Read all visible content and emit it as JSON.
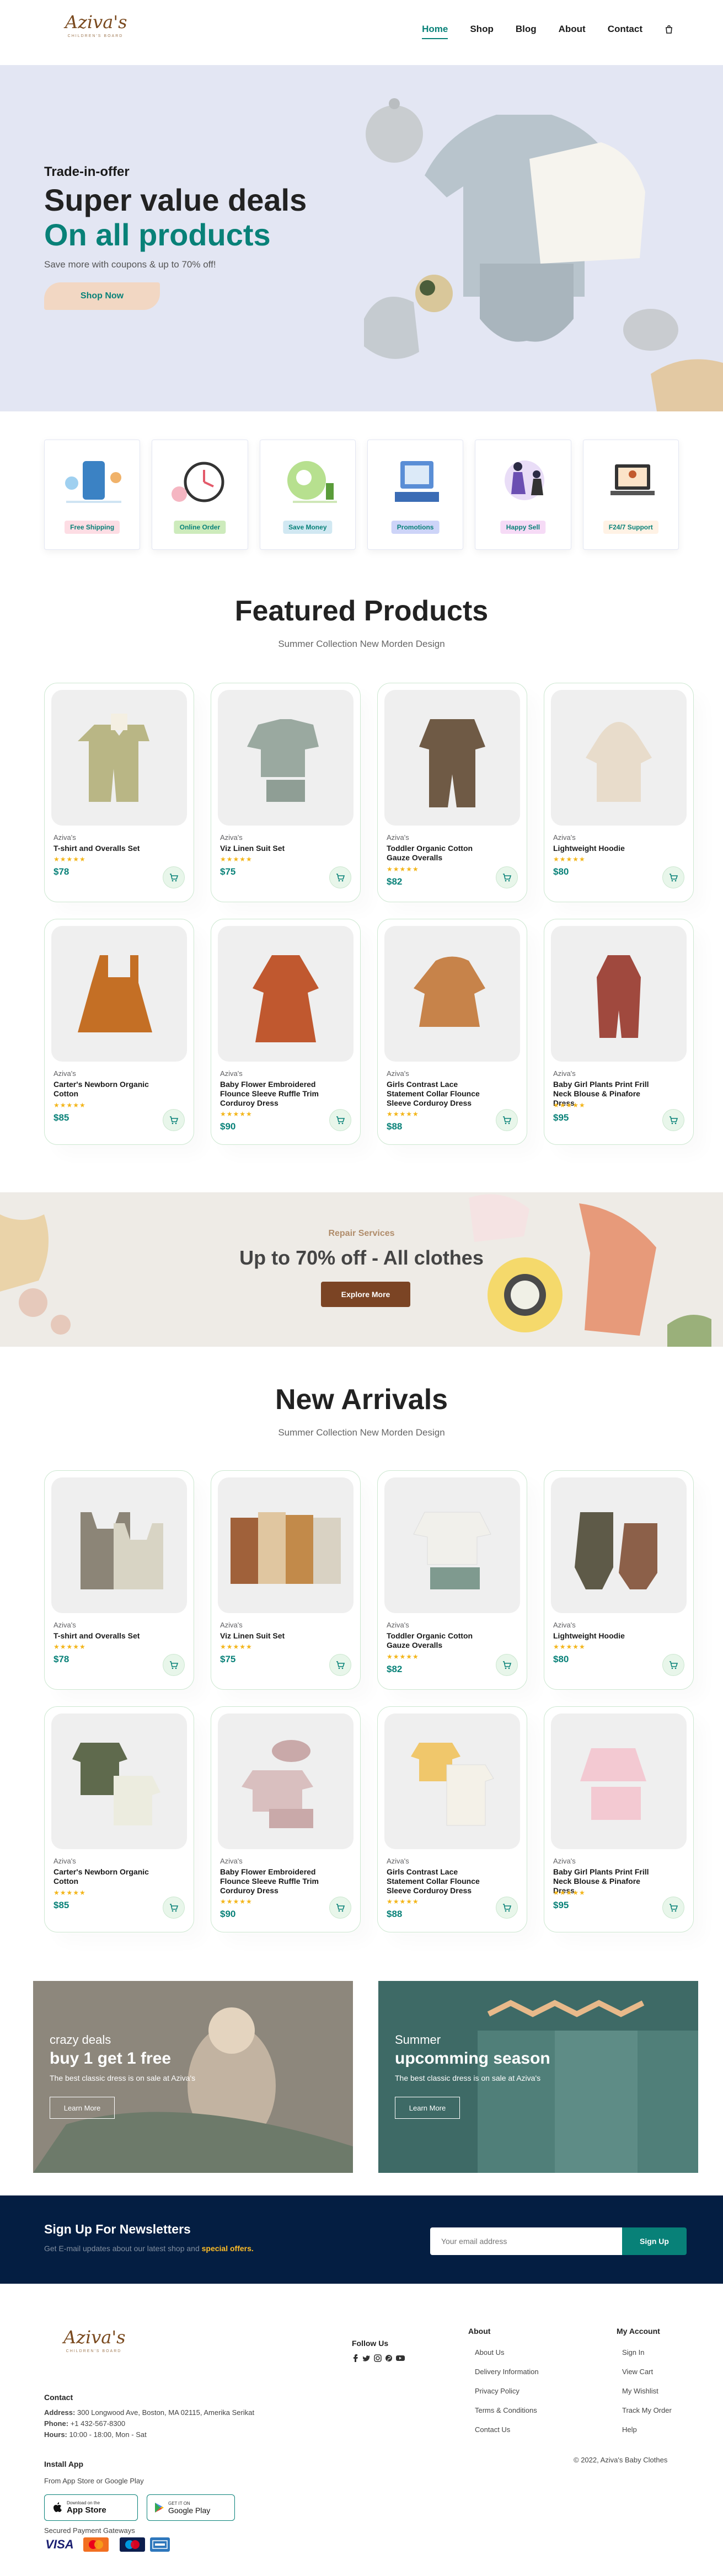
{
  "header": {
    "logo": "Aziva's",
    "logo_sub": "CHILDREN'S BOARD",
    "nav": [
      "Home",
      "Shop",
      "Blog",
      "About",
      "Contact"
    ]
  },
  "hero": {
    "pretitle": "Trade-in-offer",
    "title1": "Super value deals",
    "title2": "On all products",
    "subtitle": "Save more with coupons & up to 70% off!",
    "button": "Shop Now"
  },
  "features": [
    {
      "label": "Free Shipping",
      "bg": "#fddde4"
    },
    {
      "label": "Online Order",
      "bg": "#cdebbc"
    },
    {
      "label": "Save Money",
      "bg": "#d1e8f2"
    },
    {
      "label": "Promotions",
      "bg": "#cdd4f8"
    },
    {
      "label": "Happy Sell",
      "bg": "#f6dbf6"
    },
    {
      "label": "F24/7 Support",
      "bg": "#fff2e5"
    }
  ],
  "featured": {
    "title": "Featured Products",
    "subtitle": "Summer Collection New Morden Design"
  },
  "arrivals": {
    "title": "New Arrivals",
    "subtitle": "Summer Collection New Morden Design"
  },
  "products": [
    {
      "brand": "Aziva's",
      "name": "T-shirt and Overalls Set",
      "price": "$78"
    },
    {
      "brand": "Aziva's",
      "name": "Viz Linen Suit Set",
      "price": "$75"
    },
    {
      "brand": "Aziva's",
      "name": "Toddler Organic Cotton Gauze Overalls",
      "price": "$82"
    },
    {
      "brand": "Aziva's",
      "name": "Lightweight Hoodie",
      "price": "$80"
    },
    {
      "brand": "Aziva's",
      "name": "Carter's Newborn Organic Cotton",
      "price": "$85"
    },
    {
      "brand": "Aziva's",
      "name": "Baby Flower Embroidered Flounce Sleeve Ruffle Trim Corduroy Dress",
      "price": "$90"
    },
    {
      "brand": "Aziva's",
      "name": "Girls Contrast Lace Statement Collar Flounce Sleeve Corduroy Dress",
      "price": "$88"
    },
    {
      "brand": "Aziva's",
      "name": "Baby Girl Plants Print Frill Neck Blouse & Pinafore Dress",
      "price": "$95"
    }
  ],
  "rating": "★★★★★",
  "repair": {
    "pretitle": "Repair Services",
    "title": "Up to 70% off - All clothes",
    "button": "Explore More"
  },
  "promos": [
    {
      "small": "crazy deals",
      "title": "buy 1 get 1 free",
      "text": "The best classic dress is on sale at Aziva's",
      "button": "Learn More"
    },
    {
      "small": "Summer",
      "title": "upcomming season",
      "text": "The best classic dress is on sale at Aziva's",
      "button": "Learn More"
    }
  ],
  "newsletter": {
    "title": "Sign Up For Newsletters",
    "text_prefix": "Get E-mail updates about our latest shop and",
    "text_highlight": "special offers.",
    "placeholder": "Your email address",
    "button": "Sign Up"
  },
  "footer": {
    "contact_title": "Contact",
    "address_label": "Address:",
    "address": "300 Longwood Ave, Boston, MA 02115, Amerika Serikat",
    "phone_label": "Phone:",
    "phone": "+1 432-567-8300",
    "hours_label": "Hours:",
    "hours": "10:00 - 18:00, Mon - Sat",
    "follow_title": "Follow Us",
    "about_title": "About",
    "about_links": [
      "About Us",
      "Delivery Information",
      "Privacy Policy",
      "Terms & Conditions",
      "Contact Us"
    ],
    "account_title": "My Account",
    "account_links": [
      "Sign In",
      "View Cart",
      "My Wishlist",
      "Track My Order",
      "Help"
    ],
    "install_title": "Install App",
    "install_text": "From App Store or Google Play",
    "appstore_small": "Download on the",
    "appstore": "App Store",
    "googleplay_small": "GET IT ON",
    "googleplay": "Google Play",
    "gateways": "Secured Payment Gateways",
    "copyright": "© 2022, Aziva's Baby Clothes",
    "payments": [
      "VISA",
      "MC",
      "Maestro",
      "AMEX"
    ]
  },
  "colors": {
    "accent": "#088178",
    "hero_bg": "#e3e6f3",
    "newsletter_bg": "#041e42",
    "star": "#f3b519"
  }
}
